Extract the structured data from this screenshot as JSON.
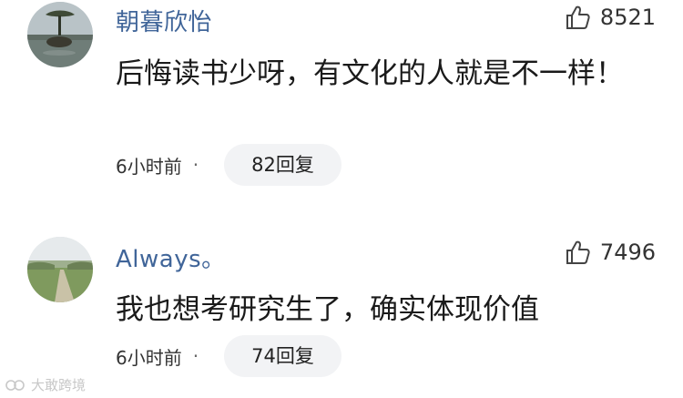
{
  "comments": [
    {
      "username": "朝暮欣怡",
      "like_count": "8521",
      "content": "后悔读书少呀，有文化的人就是不一样！",
      "time": "6小时前",
      "separator": "·",
      "reply_label": "82回复",
      "avatar_icon": "avatar-lake-tree-icon"
    },
    {
      "username": "Always。",
      "like_count": "7496",
      "content": "我也想考研究生了，确实体现价值",
      "time": "6小时前",
      "separator": "·",
      "reply_label": "74回复",
      "avatar_icon": "avatar-field-road-icon"
    }
  ],
  "watermark": {
    "text": "大敢跨境",
    "logo": "watermark-logo-icon"
  },
  "colors": {
    "username": "#406599",
    "content": "#1a1a1a",
    "reply_bg": "#f2f3f5",
    "watermark": "#c8c8c8"
  }
}
